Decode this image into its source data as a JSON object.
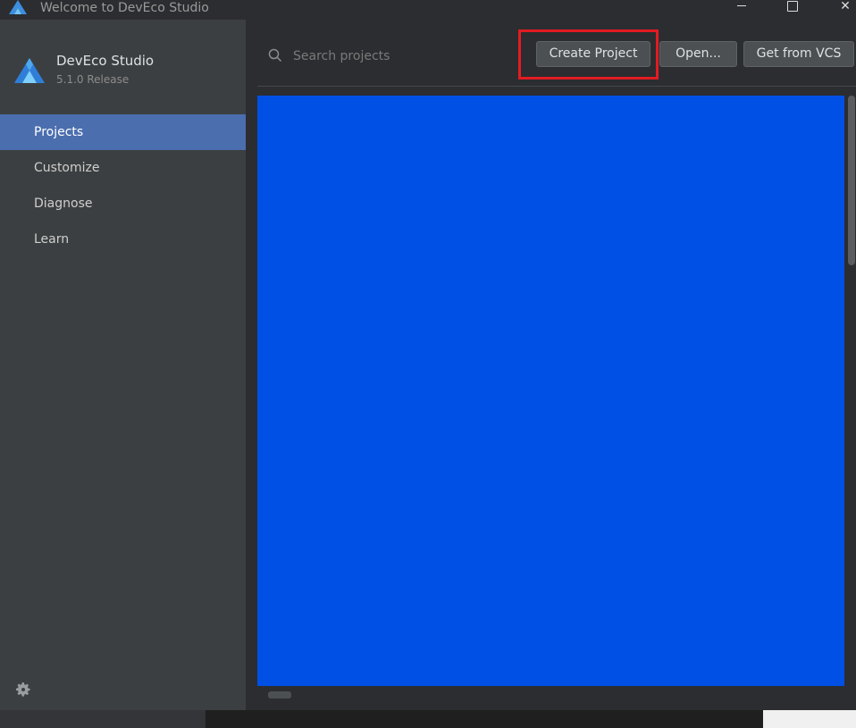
{
  "window": {
    "title": "Welcome to DevEco Studio",
    "controls": {
      "minimize": "minimize-icon",
      "maximize": "maximize-icon",
      "close": "✕"
    }
  },
  "sidebar": {
    "brand": {
      "name": "DevEco Studio",
      "version": "5.1.0 Release",
      "logo": "deveco-logo-icon"
    },
    "items": [
      {
        "label": "Projects",
        "active": true
      },
      {
        "label": "Customize",
        "active": false
      },
      {
        "label": "Diagnose",
        "active": false
      },
      {
        "label": "Learn",
        "active": false
      }
    ],
    "settings_icon": "gear-icon"
  },
  "main": {
    "search": {
      "placeholder": "Search projects",
      "value": "",
      "icon": "search-icon"
    },
    "buttons": {
      "create": "Create Project",
      "open": "Open...",
      "vcs": "Get from VCS"
    },
    "highlight_color": "#e31b23",
    "project_area_color": "#0050e6"
  },
  "colors": {
    "sidebar_bg": "#3c3f41",
    "main_bg": "#2b2d30",
    "active_item": "#4b6eaf"
  }
}
